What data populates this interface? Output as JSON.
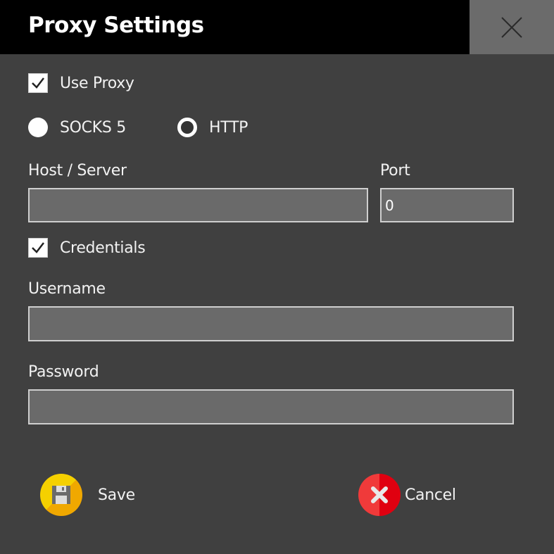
{
  "window": {
    "title": "Proxy Settings",
    "close_icon": "close-icon"
  },
  "use_proxy": {
    "label": "Use Proxy",
    "checked": true
  },
  "proxy_type": {
    "options": [
      {
        "label": "SOCKS 5",
        "selected": false
      },
      {
        "label": "HTTP",
        "selected": true
      }
    ]
  },
  "host": {
    "label": "Host / Server",
    "value": ""
  },
  "port": {
    "label": "Port",
    "value": "0"
  },
  "credentials": {
    "label": "Credentials",
    "checked": true
  },
  "username": {
    "label": "Username",
    "value": ""
  },
  "password": {
    "label": "Password",
    "value": ""
  },
  "buttons": {
    "save": "Save",
    "cancel": "Cancel"
  },
  "colors": {
    "save_icon": "#f5c400",
    "cancel_icon": "#e8222a",
    "titlebar": "#000000",
    "background": "#404040"
  }
}
